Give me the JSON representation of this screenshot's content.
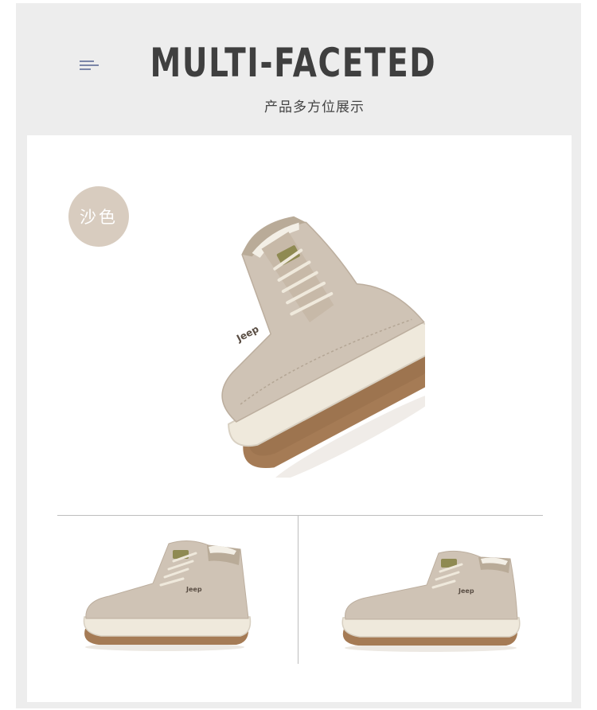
{
  "header": {
    "title": "MULTI-FACETED",
    "subtitle": "产品多方位展示",
    "menu_icon": "menu-lines-icon"
  },
  "product": {
    "color_badge": "沙色",
    "brand_mark": "Jeep",
    "views": [
      "hero-angled-view",
      "side-view-left",
      "side-view-right"
    ]
  },
  "colors": {
    "background": "#ededed",
    "panel": "#ffffff",
    "badge": "#d8ccbf",
    "suede": "#cfc3b5",
    "sole": "#efe9dc",
    "outsole": "#a57b55",
    "title": "#3f3f3f"
  }
}
